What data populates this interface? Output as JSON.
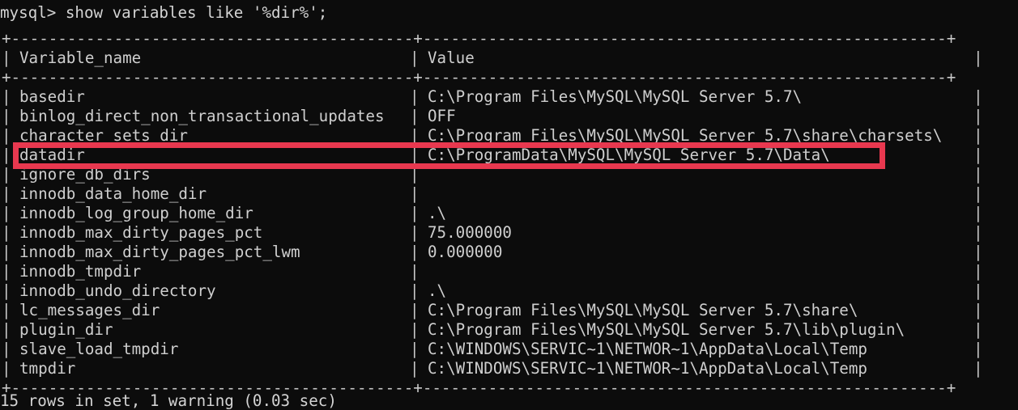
{
  "terminal": {
    "prompt_line": "mysql> show variables like '%dir%';",
    "status_line": "15 rows in set, 1 warning (0.03 sec)",
    "background_color": "#0c0c0c",
    "text_color": "#d4d4d4",
    "highlight_color": "#e8384f"
  },
  "table": {
    "rule_top": "+-------------------------------------------+--------------------------------------------------------+",
    "rule_header": "+-------------------------------------------+--------------------------------------------------------+",
    "rule_bottom": "+-------------------------------------------+--------------------------------------------------------+",
    "bar": "|",
    "headers": {
      "variable_name": "Variable_name",
      "value": "Value"
    },
    "rows": [
      {
        "variable_name": "basedir",
        "value": "C:\\Program Files\\MySQL\\MySQL Server 5.7\\"
      },
      {
        "variable_name": "binlog_direct_non_transactional_updates",
        "value": "OFF"
      },
      {
        "variable_name": "character_sets_dir",
        "value": "C:\\Program Files\\MySQL\\MySQL Server 5.7\\share\\charsets\\"
      },
      {
        "variable_name": "datadir",
        "value": "C:\\ProgramData\\MySQL\\MySQL Server 5.7\\Data\\"
      },
      {
        "variable_name": "ignore_db_dirs",
        "value": ""
      },
      {
        "variable_name": "innodb_data_home_dir",
        "value": ""
      },
      {
        "variable_name": "innodb_log_group_home_dir",
        "value": ".\\"
      },
      {
        "variable_name": "innodb_max_dirty_pages_pct",
        "value": "75.000000"
      },
      {
        "variable_name": "innodb_max_dirty_pages_pct_lwm",
        "value": "0.000000"
      },
      {
        "variable_name": "innodb_tmpdir",
        "value": ""
      },
      {
        "variable_name": "innodb_undo_directory",
        "value": ".\\"
      },
      {
        "variable_name": "lc_messages_dir",
        "value": "C:\\Program Files\\MySQL\\MySQL Server 5.7\\share\\"
      },
      {
        "variable_name": "plugin_dir",
        "value": "C:\\Program Files\\MySQL\\MySQL Server 5.7\\lib\\plugin\\"
      },
      {
        "variable_name": "slave_load_tmpdir",
        "value": "C:\\WINDOWS\\SERVIC~1\\NETWOR~1\\AppData\\Local\\Temp"
      },
      {
        "variable_name": "tmpdir",
        "value": "C:\\WINDOWS\\SERVIC~1\\NETWOR~1\\AppData\\Local\\Temp"
      }
    ]
  },
  "annotation": {
    "highlighted_row_variable": "datadir",
    "highlighted_row_value": "C:\\ProgramData\\MySQL\\MySQL Server 5.7\\Data\\"
  }
}
